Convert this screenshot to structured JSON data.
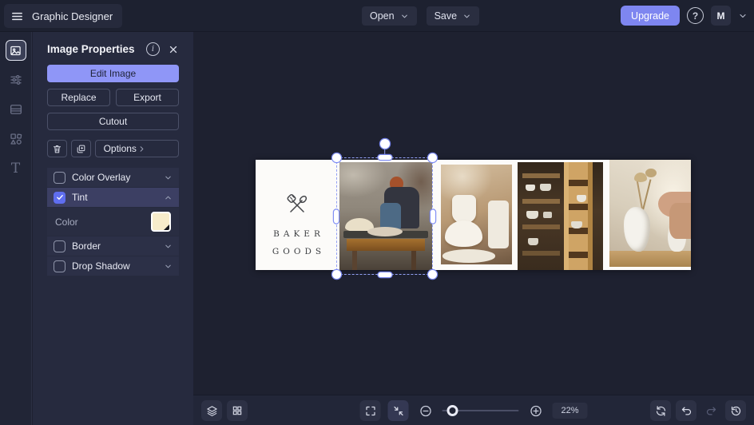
{
  "app": {
    "title": "Graphic Designer"
  },
  "topbar": {
    "open_label": "Open",
    "save_label": "Save",
    "upgrade_label": "Upgrade",
    "help_glyph": "?",
    "avatar_initial": "M"
  },
  "sidebar": {
    "text_glyph": "T",
    "items": [
      {
        "id": "media",
        "icon": "image-icon",
        "active": true
      },
      {
        "id": "adjust",
        "icon": "sliders-icon",
        "active": false
      },
      {
        "id": "pages",
        "icon": "pages-icon",
        "active": false
      },
      {
        "id": "elements",
        "icon": "shapes-icon",
        "active": false
      },
      {
        "id": "text",
        "icon": "text-icon",
        "active": false
      }
    ]
  },
  "panel": {
    "title": "Image Properties",
    "info_glyph": "i",
    "edit_image_label": "Edit Image",
    "replace_label": "Replace",
    "export_label": "Export",
    "cutout_label": "Cutout",
    "options_label": "Options",
    "sections": [
      {
        "label": "Color Overlay",
        "checked": false,
        "expanded": false
      },
      {
        "label": "Tint",
        "checked": true,
        "expanded": true
      },
      {
        "label": "Border",
        "checked": false,
        "expanded": false
      },
      {
        "label": "Drop Shadow",
        "checked": false,
        "expanded": false
      }
    ],
    "tint": {
      "color_label": "Color",
      "color_value": "#F7ECCB"
    }
  },
  "canvas": {
    "brand": {
      "line1": "BAKER",
      "line2": "GOODS"
    },
    "photos": [
      "pottery-woman",
      "ceramic-bowls",
      "wooden-shelves",
      "vase-with-hand"
    ],
    "selected_photo": "pottery-woman"
  },
  "bottombar": {
    "zoom_level": "22%"
  },
  "colors": {
    "accent": "#7E86F0",
    "edit_button": "#8F96F7",
    "selection": "#93A0F5",
    "checkbox_checked": "#5F6EF0",
    "tint_swatch": "#F7ECCB",
    "artboard": "#FCFBF9"
  }
}
